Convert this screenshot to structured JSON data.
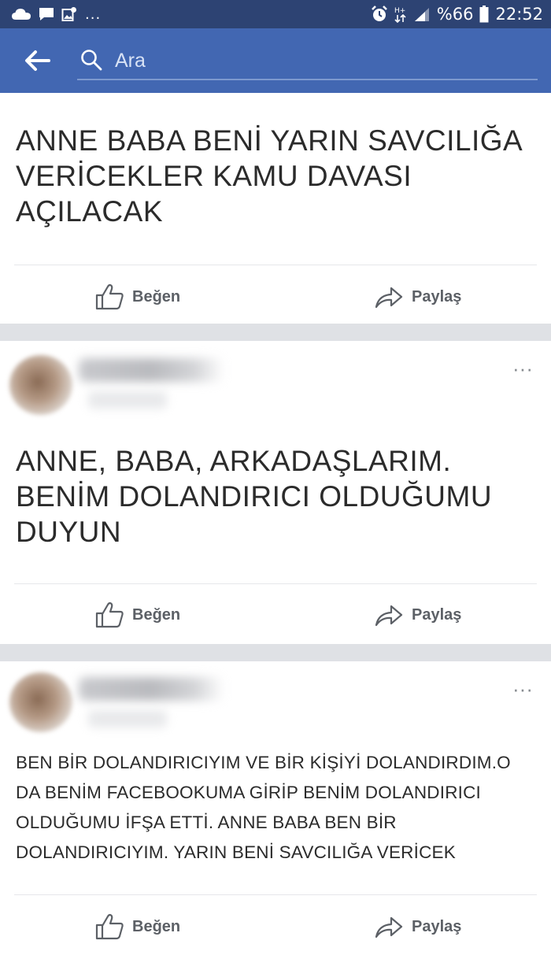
{
  "status_bar": {
    "battery": "%66",
    "time": "22:52",
    "overflow": "..."
  },
  "search": {
    "placeholder": "Ara"
  },
  "posts": [
    {
      "text": "ANNE BABA BENİ YARIN SAVCILIĞA VERİCEKLER KAMU DAVASI AÇILACAK",
      "like_label": "Beğen",
      "share_label": "Paylaş"
    },
    {
      "author_blurred": true,
      "more": "···",
      "text": "ANNE, BABA, ARKADAŞLARIM. BENİM DOLANDIRICI OLDUĞUMU DUYUN",
      "like_label": "Beğen",
      "share_label": "Paylaş"
    },
    {
      "author_blurred": true,
      "more": "···",
      "text": "BEN BİR DOLANDIRICIYIM VE BİR KİŞİYİ DOLANDIRDIM.O DA BENİM FACEBOOKUMA GİRİP BENİM DOLANDIRICI OLDUĞUMU İFŞA ETTİ. ANNE BABA BEN BİR DOLANDIRICIYIM. YARIN BENİ SAVCILIĞA VERİCEK",
      "like_label": "Beğen",
      "share_label": "Paylaş"
    }
  ],
  "colors": {
    "status_bar": "#2d4373",
    "app_bar": "#4267b2",
    "feed_gap": "#dfe1e5",
    "post_text": "#2b2b2b",
    "action_text": "#5c6066"
  }
}
